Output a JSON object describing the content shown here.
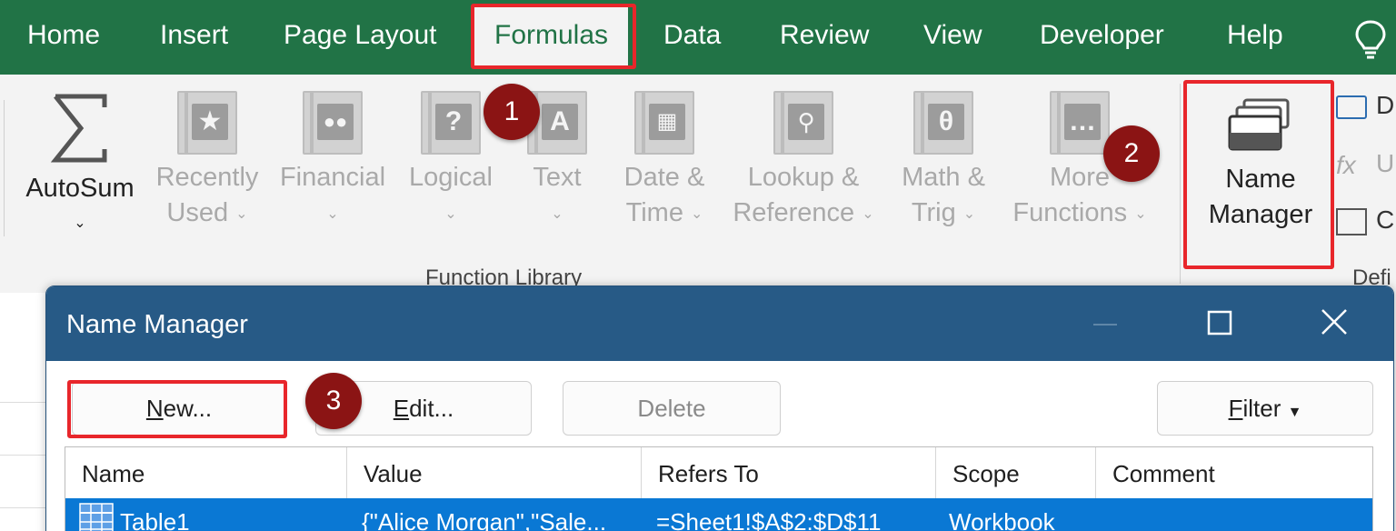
{
  "ribbon_tabs": [
    "Home",
    "Insert",
    "Page Layout",
    "Formulas",
    "Data",
    "Review",
    "View",
    "Developer",
    "Help"
  ],
  "active_tab": "Formulas",
  "function_library": {
    "autosum": "AutoSum",
    "recently_used": [
      "Recently",
      "Used"
    ],
    "financial": "Financial",
    "logical": "Logical",
    "text": "Text",
    "date_time": [
      "Date &",
      "Time"
    ],
    "lookup_reference": [
      "Lookup &",
      "Reference"
    ],
    "math_trig": [
      "Math &",
      "Trig"
    ],
    "more_functions": [
      "More",
      "Functions"
    ],
    "group_label": "Function Library"
  },
  "defined_names": {
    "name_manager": [
      "Name",
      "Manager"
    ],
    "side_items": [
      "D",
      "U",
      "C"
    ],
    "group_label_partial": "Defi"
  },
  "badges": [
    "1",
    "2",
    "3"
  ],
  "dialog": {
    "title": "Name Manager",
    "buttons": {
      "new": {
        "underline": "N",
        "rest": "ew..."
      },
      "edit": {
        "underline": "E",
        "rest": "dit..."
      },
      "delete": "Delete",
      "filter": {
        "underline": "F",
        "rest": "ilter"
      }
    },
    "columns": [
      "Name",
      "Value",
      "Refers To",
      "Scope",
      "Comment"
    ],
    "rows": [
      {
        "name": "Table1",
        "value": "{\"Alice Morgan\",\"Sale...",
        "refers_to": "=Sheet1!$A$2:$D$11",
        "scope": "Workbook",
        "comment": ""
      }
    ]
  },
  "colors": {
    "ribbon_green": "#217346",
    "dialog_title": "#275a86",
    "selection": "#0a78d4",
    "highlight_red": "#e8262b",
    "badge": "#8b1414"
  }
}
